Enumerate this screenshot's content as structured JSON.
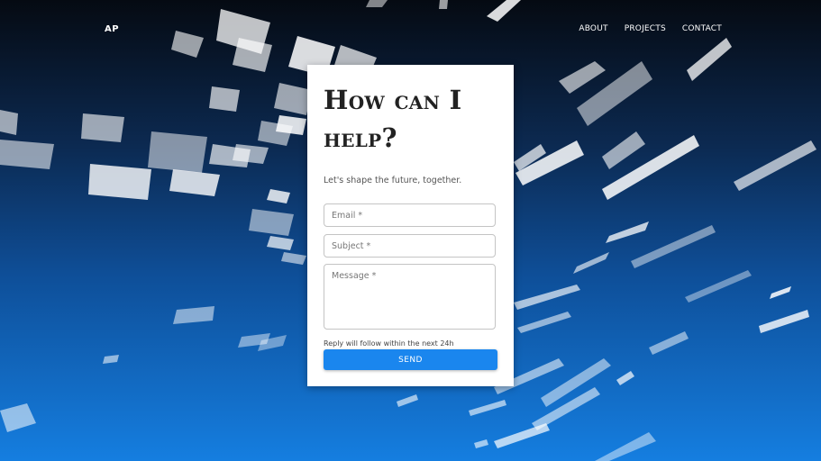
{
  "brand": {
    "logo_text": "AP"
  },
  "nav": {
    "items": [
      {
        "label": "ABOUT"
      },
      {
        "label": "PROJECTS"
      },
      {
        "label": "CONTACT"
      }
    ]
  },
  "contact_form": {
    "title": "How can I help?",
    "subtitle": "Let's shape the future, together.",
    "email_placeholder": "Email *",
    "subject_placeholder": "Subject *",
    "message_placeholder": "Message *",
    "reply_note": "Reply will follow within the next 24h",
    "send_label": "SEND"
  },
  "colors": {
    "background_top": "#050a12",
    "background_bottom": "#157ee0",
    "send_button": "#1a86ee",
    "card": "#ffffff"
  }
}
